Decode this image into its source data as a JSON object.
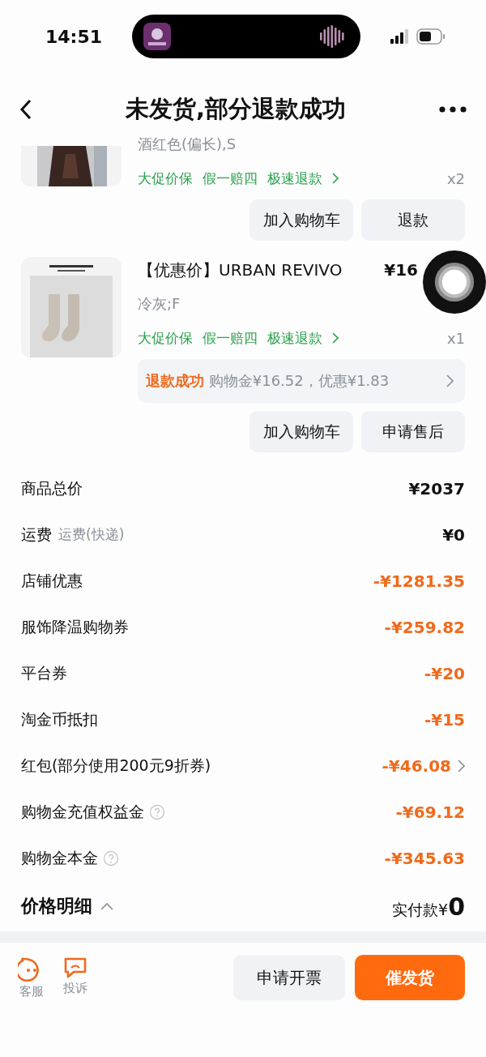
{
  "status_bar": {
    "time": "14:51"
  },
  "header": {
    "title": "未发货,部分退款成功"
  },
  "items": [
    {
      "kind": "cut",
      "variant": "酒红色(偏长),S",
      "tags": [
        "大促价保",
        "假一赔四",
        "极速退款"
      ],
      "quantity": "x2",
      "buttons": [
        "加入购物车",
        "退款"
      ]
    },
    {
      "kind": "full",
      "title": "【优惠价】URBAN REVIVO",
      "price": "¥16",
      "variant": "冷灰;F",
      "tags": [
        "大促价保",
        "假一赔四",
        "极速退款"
      ],
      "quantity": "x1",
      "refund": {
        "status": "退款成功",
        "detail": "购物金¥16.52，优惠¥1.83"
      },
      "buttons": [
        "加入购物车",
        "申请售后"
      ]
    }
  ],
  "price_rows": [
    {
      "label": "商品总价",
      "kind": "amount",
      "value": "¥2037"
    },
    {
      "label": "运费",
      "note": "运费(快递)",
      "kind": "amount",
      "value": "¥0"
    },
    {
      "label": "店铺优惠",
      "kind": "discount",
      "value": "-¥1281.35"
    },
    {
      "label": "服饰降温购物券",
      "kind": "discount",
      "value": "-¥259.82"
    },
    {
      "label": "平台券",
      "kind": "discount",
      "value": "-¥20"
    },
    {
      "label": "淘金币抵扣",
      "kind": "discount",
      "value": "-¥15"
    },
    {
      "label": "红包(部分使用200元9折券)",
      "kind": "discount",
      "value": "-¥46.08",
      "link": true
    },
    {
      "label": "购物金充值权益金",
      "kind": "discount",
      "value": "-¥69.12",
      "help": true
    },
    {
      "label": "购物金本金",
      "kind": "discount",
      "value": "-¥345.63",
      "help": true
    }
  ],
  "summary": {
    "label": "价格明细",
    "expanded": true,
    "total_label": "实付款¥",
    "total": "0"
  },
  "bottom_bar": {
    "shortcuts": [
      {
        "kind": "service",
        "label": "客服"
      },
      {
        "kind": "complaint",
        "label": "投诉"
      }
    ],
    "buttons": [
      {
        "kind": "secondary",
        "label": "申请开票"
      },
      {
        "kind": "primary",
        "label": "催发货"
      }
    ]
  }
}
